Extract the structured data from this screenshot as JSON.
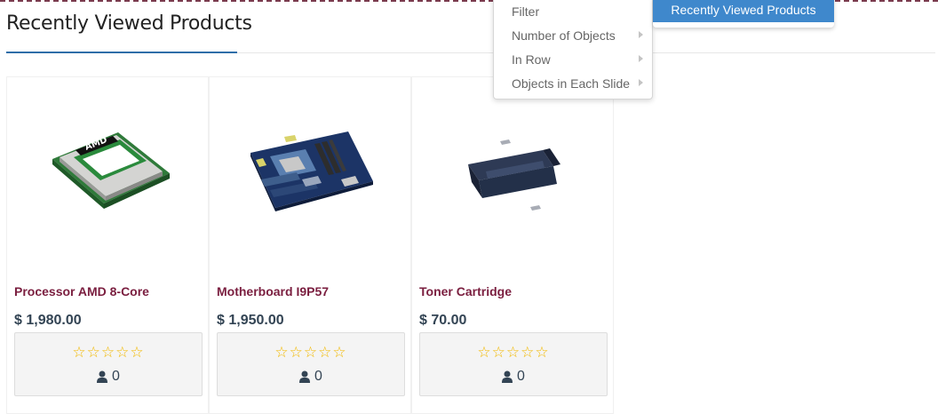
{
  "section": {
    "title": "Recently Viewed Products"
  },
  "products": [
    {
      "name": "Processor AMD 8-Core",
      "price": "$ 1,980.00",
      "stars": "☆☆☆☆☆",
      "reviews": "0",
      "image": "cpu-chip-image"
    },
    {
      "name": "Motherboard I9P57",
      "price": "$ 1,950.00",
      "stars": "☆☆☆☆☆",
      "reviews": "0",
      "image": "motherboard-image"
    },
    {
      "name": "Toner Cartridge",
      "price": "$ 70.00",
      "stars": "☆☆☆☆☆",
      "reviews": "0",
      "image": "toner-cartridge-image"
    }
  ],
  "context_menu": {
    "items": [
      {
        "label": "Filter",
        "has_submenu": false
      },
      {
        "label": "Number of Objects",
        "has_submenu": true
      },
      {
        "label": "In Row",
        "has_submenu": true
      },
      {
        "label": "Objects in Each Slide",
        "has_submenu": true
      }
    ]
  },
  "submenu": {
    "active_label": "Recently Viewed Products"
  },
  "chip_logo": "AMD",
  "colors": {
    "product_name": "#7a1e3f",
    "price": "#334454",
    "star": "#f2b900",
    "accent": "#2f6ea8",
    "menu_highlight": "#3f88cc"
  }
}
